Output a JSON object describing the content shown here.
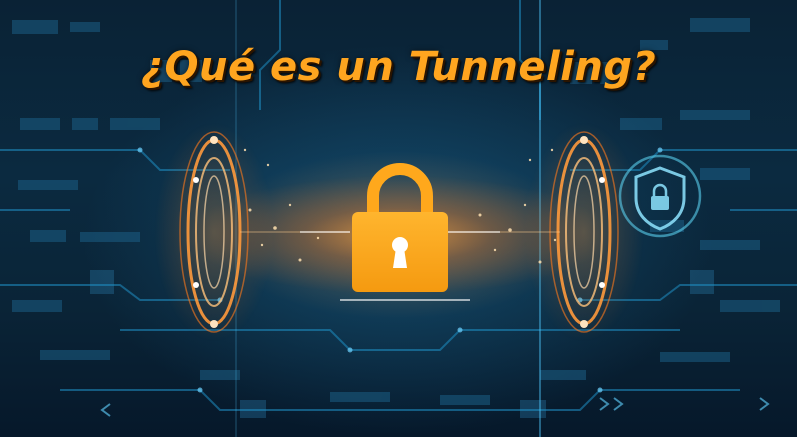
{
  "title": "¿Qué es un Tunneling?",
  "colors": {
    "title": "#ffa51f",
    "padlock": "#ffa81c",
    "background_dark": "#061623",
    "circuit_blue": "#1d86b8",
    "glow_orange": "#ff7a1a"
  },
  "icons": [
    "padlock-icon",
    "shield-lock-icon",
    "portal-ring-left",
    "portal-ring-right"
  ]
}
